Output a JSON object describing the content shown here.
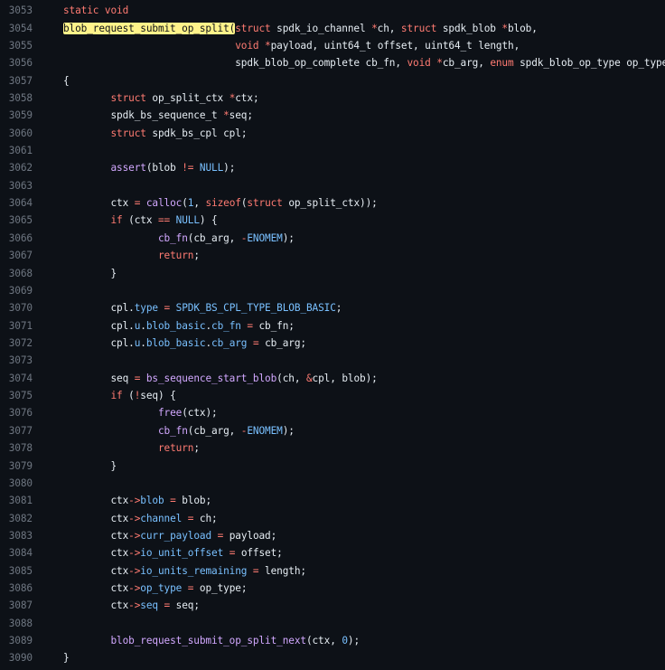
{
  "code": {
    "lines": [
      {
        "n": "3053",
        "t": "static void"
      },
      {
        "n": "3054",
        "t": "blob_request_submit_op_split(struct spdk_io_channel *ch, struct spdk_blob *blob,"
      },
      {
        "n": "3055",
        "t": "                             void *payload, uint64_t offset, uint64_t length,"
      },
      {
        "n": "3056",
        "t": "                             spdk_blob_op_complete cb_fn, void *cb_arg, enum spdk_blob_op_type op_type)"
      },
      {
        "n": "3057",
        "t": "{"
      },
      {
        "n": "3058",
        "t": "        struct op_split_ctx *ctx;"
      },
      {
        "n": "3059",
        "t": "        spdk_bs_sequence_t *seq;"
      },
      {
        "n": "3060",
        "t": "        struct spdk_bs_cpl cpl;"
      },
      {
        "n": "3061",
        "t": ""
      },
      {
        "n": "3062",
        "t": "        assert(blob != NULL);"
      },
      {
        "n": "3063",
        "t": ""
      },
      {
        "n": "3064",
        "t": "        ctx = calloc(1, sizeof(struct op_split_ctx));"
      },
      {
        "n": "3065",
        "t": "        if (ctx == NULL) {"
      },
      {
        "n": "3066",
        "t": "                cb_fn(cb_arg, -ENOMEM);"
      },
      {
        "n": "3067",
        "t": "                return;"
      },
      {
        "n": "3068",
        "t": "        }"
      },
      {
        "n": "3069",
        "t": ""
      },
      {
        "n": "3070",
        "t": "        cpl.type = SPDK_BS_CPL_TYPE_BLOB_BASIC;"
      },
      {
        "n": "3071",
        "t": "        cpl.u.blob_basic.cb_fn = cb_fn;"
      },
      {
        "n": "3072",
        "t": "        cpl.u.blob_basic.cb_arg = cb_arg;"
      },
      {
        "n": "3073",
        "t": ""
      },
      {
        "n": "3074",
        "t": "        seq = bs_sequence_start_blob(ch, &cpl, blob);"
      },
      {
        "n": "3075",
        "t": "        if (!seq) {"
      },
      {
        "n": "3076",
        "t": "                free(ctx);"
      },
      {
        "n": "3077",
        "t": "                cb_fn(cb_arg, -ENOMEM);"
      },
      {
        "n": "3078",
        "t": "                return;"
      },
      {
        "n": "3079",
        "t": "        }"
      },
      {
        "n": "3080",
        "t": ""
      },
      {
        "n": "3081",
        "t": "        ctx->blob = blob;"
      },
      {
        "n": "3082",
        "t": "        ctx->channel = ch;"
      },
      {
        "n": "3083",
        "t": "        ctx->curr_payload = payload;"
      },
      {
        "n": "3084",
        "t": "        ctx->io_unit_offset = offset;"
      },
      {
        "n": "3085",
        "t": "        ctx->io_units_remaining = length;"
      },
      {
        "n": "3086",
        "t": "        ctx->op_type = op_type;"
      },
      {
        "n": "3087",
        "t": "        ctx->seq = seq;"
      },
      {
        "n": "3088",
        "t": ""
      },
      {
        "n": "3089",
        "t": "        blob_request_submit_op_split_next(ctx, 0);"
      },
      {
        "n": "3090",
        "t": "}"
      }
    ],
    "highlight": "blob_request_submit_op_split(",
    "colors": {
      "background": "#0d1117",
      "text": "#e6edf3",
      "line_number": "#6e7681",
      "keyword": "#ff7b72",
      "function": "#d2a8ff",
      "constant": "#79c0ff",
      "highlight_bg": "#fff38a"
    }
  }
}
